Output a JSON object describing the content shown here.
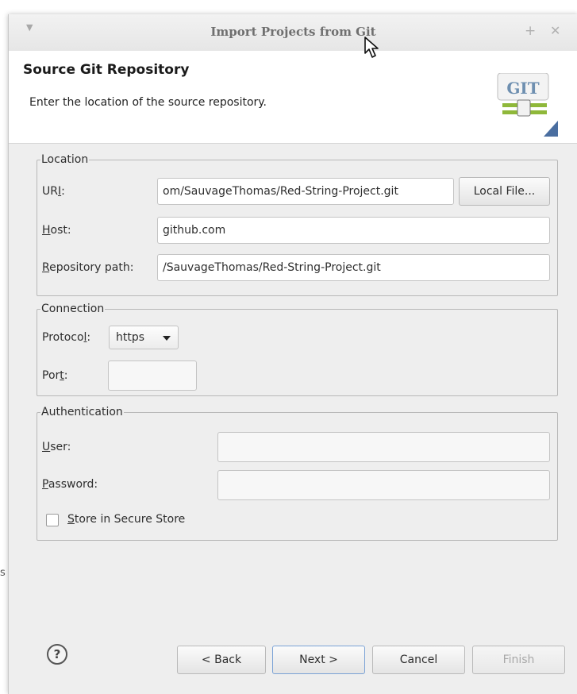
{
  "background": {
    "side_glyph": "s"
  },
  "window": {
    "title": "Import Projects from Git",
    "maximize_glyph": "+",
    "close_glyph": "✕"
  },
  "banner": {
    "title": "Source Git Repository",
    "description": "Enter the location of the source repository.",
    "logo_text": "GIT"
  },
  "location": {
    "legend": "Location",
    "uri_label_prefix": "UR",
    "uri_label_mnemonic": "I",
    "uri_label_suffix": ":",
    "uri_value": "om/SauvageThomas/Red-String-Project.git",
    "local_file_button": "Local File...",
    "host_label_mnemonic": "H",
    "host_label_rest": "ost:",
    "host_value": "github.com",
    "repo_label_mnemonic": "R",
    "repo_label_rest": "epository path:",
    "repo_value": "/SauvageThomas/Red-String-Project.git"
  },
  "connection": {
    "legend": "Connection",
    "protocol_label_prefix": "Protoco",
    "protocol_label_mnemonic": "l",
    "protocol_label_suffix": ":",
    "protocol_value": "https",
    "port_label_prefix": "Por",
    "port_label_mnemonic": "t",
    "port_label_suffix": ":",
    "port_value": ""
  },
  "authentication": {
    "legend": "Authentication",
    "user_label_mnemonic": "U",
    "user_label_rest": "ser:",
    "user_value": "",
    "password_label_mnemonic": "P",
    "password_label_rest": "assword:",
    "password_value": "",
    "store_label_mnemonic": "S",
    "store_label_rest": "tore in Secure Store",
    "store_checked": false
  },
  "footer": {
    "help_glyph": "?",
    "back_button": "< Back",
    "next_button": "Next >",
    "cancel_button": "Cancel",
    "finish_button": "Finish"
  },
  "colors": {
    "dialog_bg": "#eeeeee",
    "accent_border": "#7aa2d6",
    "logo_green": "#8fb83a"
  }
}
